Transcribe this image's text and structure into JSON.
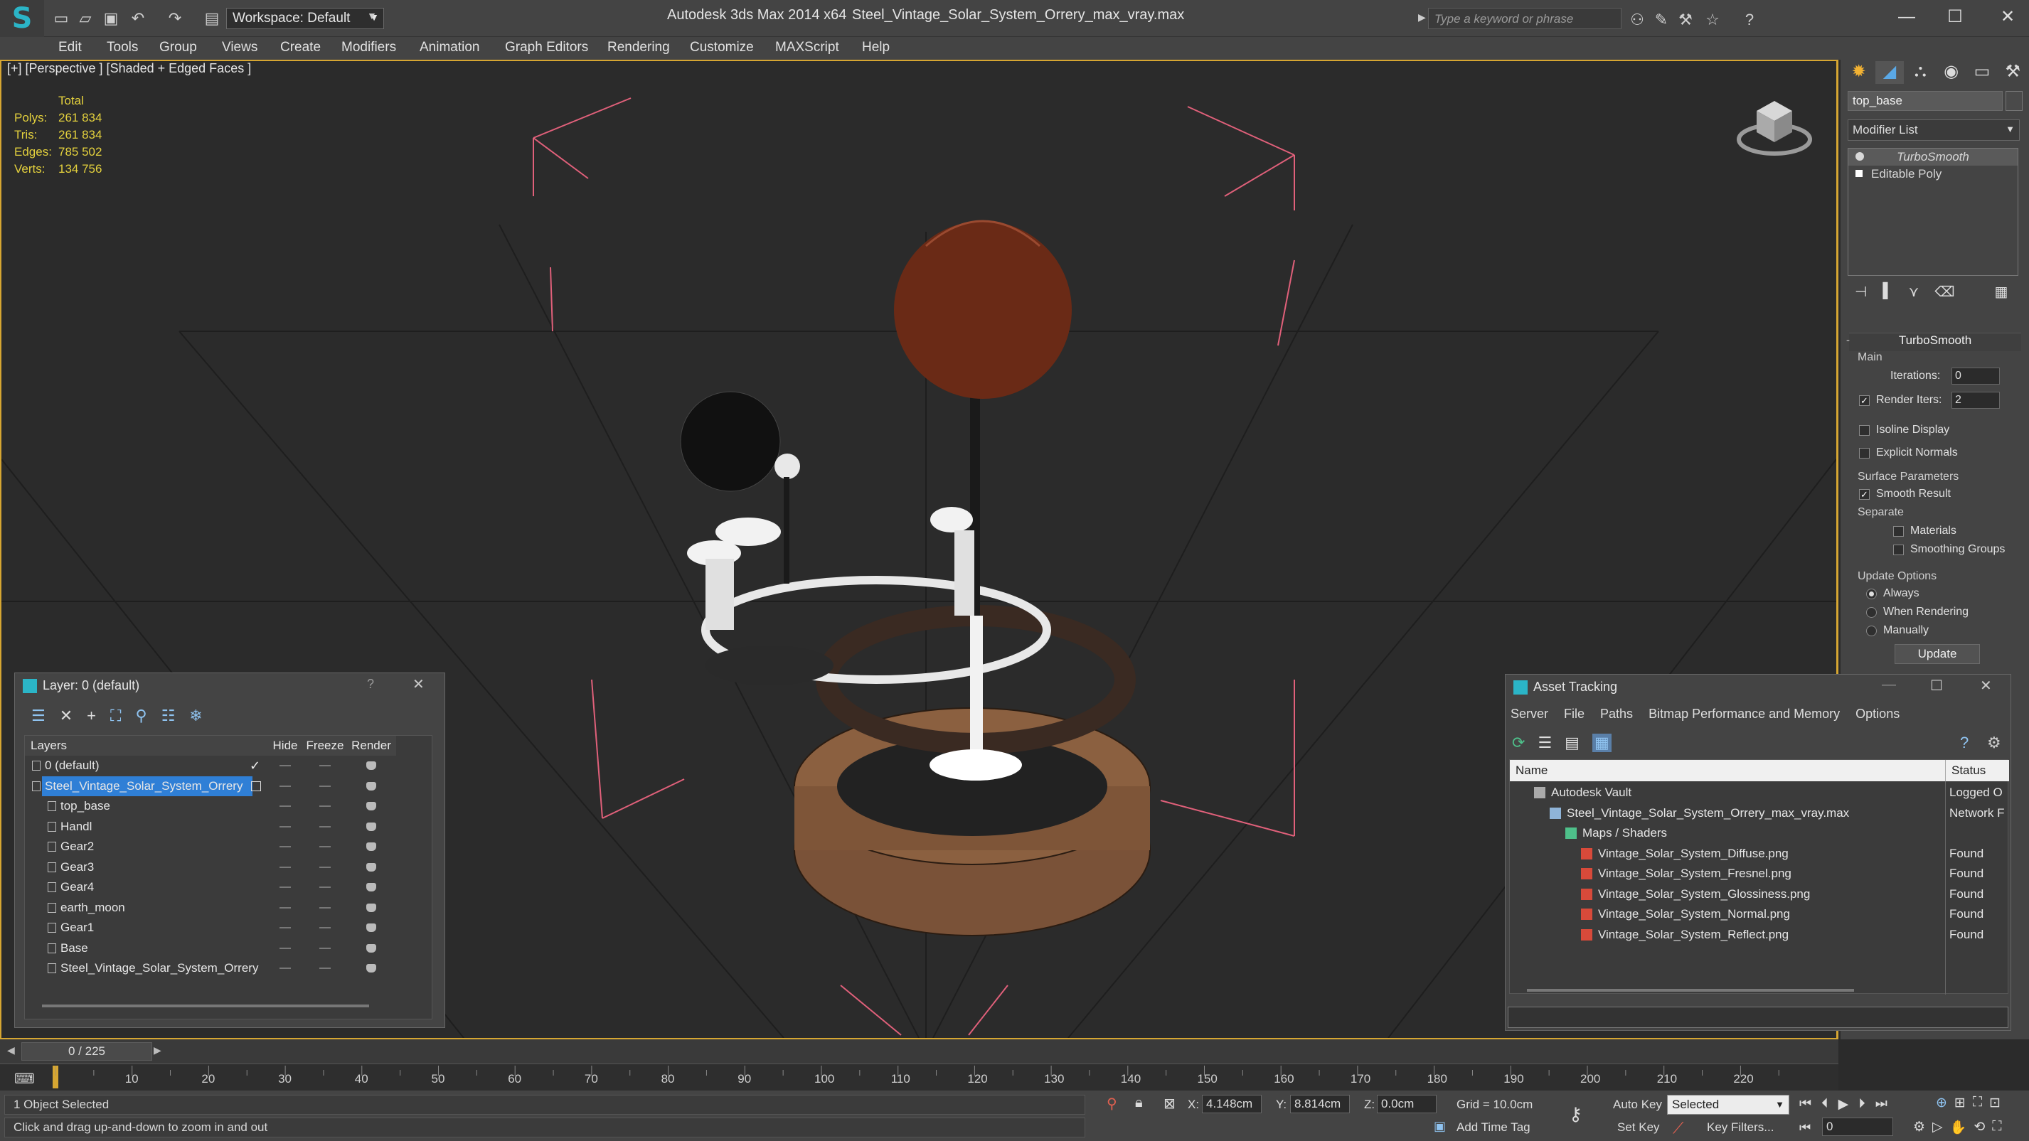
{
  "titlebar": {
    "workspace": "Workspace: Default",
    "app_title": "Autodesk 3ds Max  2014 x64",
    "file_title": "Steel_Vintage_Solar_System_Orrery_max_vray.max",
    "search_placeholder": "Type a keyword or phrase"
  },
  "menu": [
    "Edit",
    "Tools",
    "Group",
    "Views",
    "Create",
    "Modifiers",
    "Animation",
    "Graph Editors",
    "Rendering",
    "Customize",
    "MAXScript",
    "Help"
  ],
  "viewport": {
    "label": "[+] [Perspective ] [Shaded + Edged Faces ]",
    "stats": {
      "header": "Total",
      "rows": [
        {
          "k": "Polys:",
          "v": "261 834"
        },
        {
          "k": "Tris:",
          "v": "261 834"
        },
        {
          "k": "Edges:",
          "v": "785 502"
        },
        {
          "k": "Verts:",
          "v": "134 756"
        }
      ]
    }
  },
  "command_panel": {
    "object_name": "top_base",
    "modifier_list": "Modifier List",
    "stack": [
      "TurboSmooth",
      "Editable Poly"
    ],
    "rollout_title": "TurboSmooth",
    "main_label": "Main",
    "iterations_label": "Iterations:",
    "iterations_value": "0",
    "render_iters_label": "Render Iters:",
    "render_iters_value": "2",
    "isoline": "Isoline Display",
    "explicit_normals": "Explicit Normals",
    "surface_params": "Surface Parameters",
    "smooth_result": "Smooth Result",
    "separate": "Separate",
    "materials": "Materials",
    "smoothing_groups": "Smoothing Groups",
    "update_options": "Update Options",
    "always": "Always",
    "when_rendering": "When Rendering",
    "manually": "Manually",
    "update_button": "Update"
  },
  "layer_dialog": {
    "title": "Layer: 0 (default)",
    "help": "?",
    "columns": [
      "Layers",
      "Hide",
      "Freeze",
      "Render"
    ],
    "rows": [
      {
        "name": "0 (default)",
        "indent": 0
      },
      {
        "name": "Steel_Vintage_Solar_System_Orrery",
        "indent": 0
      },
      {
        "name": "top_base",
        "indent": 1
      },
      {
        "name": "Handl",
        "indent": 1
      },
      {
        "name": "Gear2",
        "indent": 1
      },
      {
        "name": "Gear3",
        "indent": 1
      },
      {
        "name": "Gear4",
        "indent": 1
      },
      {
        "name": "earth_moon",
        "indent": 1
      },
      {
        "name": "Gear1",
        "indent": 1
      },
      {
        "name": "Base",
        "indent": 1
      },
      {
        "name": "Steel_Vintage_Solar_System_Orrery",
        "indent": 1
      }
    ]
  },
  "asset_dialog": {
    "title": "Asset Tracking",
    "menu": [
      "Server",
      "File",
      "Paths",
      "Bitmap Performance and Memory",
      "Options"
    ],
    "columns": [
      "Name",
      "Status"
    ],
    "rows": [
      {
        "name": "Autodesk Vault",
        "status": "Logged O",
        "level": 1
      },
      {
        "name": "Steel_Vintage_Solar_System_Orrery_max_vray.max",
        "status": "Network F",
        "level": 2
      },
      {
        "name": "Maps / Shaders",
        "status": "",
        "level": 3
      },
      {
        "name": "Vintage_Solar_System_Diffuse.png",
        "status": "Found",
        "level": 4
      },
      {
        "name": "Vintage_Solar_System_Fresnel.png",
        "status": "Found",
        "level": 4
      },
      {
        "name": "Vintage_Solar_System_Glossiness.png",
        "status": "Found",
        "level": 4
      },
      {
        "name": "Vintage_Solar_System_Normal.png",
        "status": "Found",
        "level": 4
      },
      {
        "name": "Vintage_Solar_System_Reflect.png",
        "status": "Found",
        "level": 4
      }
    ]
  },
  "timeline": {
    "frame": "0 / 225",
    "ticks": [
      "10",
      "20",
      "30",
      "40",
      "50",
      "60",
      "70",
      "80",
      "90",
      "100",
      "110",
      "120",
      "130",
      "140",
      "150",
      "160",
      "170",
      "180",
      "190",
      "200",
      "210",
      "220"
    ]
  },
  "status": {
    "selected": "1 Object Selected",
    "prompt": "Click and drag up-and-down to zoom in and out",
    "x_label": "X:",
    "x": "4.148cm",
    "y_label": "Y:",
    "y": "8.814cm",
    "z_label": "Z:",
    "z": "0.0cm",
    "grid": "Grid = 10.0cm",
    "auto_key": "Auto Key",
    "set_key": "Set Key",
    "selected_dropdown": "Selected",
    "key_filters": "Key Filters...",
    "add_time_tag": "Add Time Tag",
    "frame_field": "0"
  },
  "colors": {
    "accent_yellow": "#d6a632",
    "selection_blue": "#2f7fd6",
    "stats_yellow": "#e4d13d"
  }
}
